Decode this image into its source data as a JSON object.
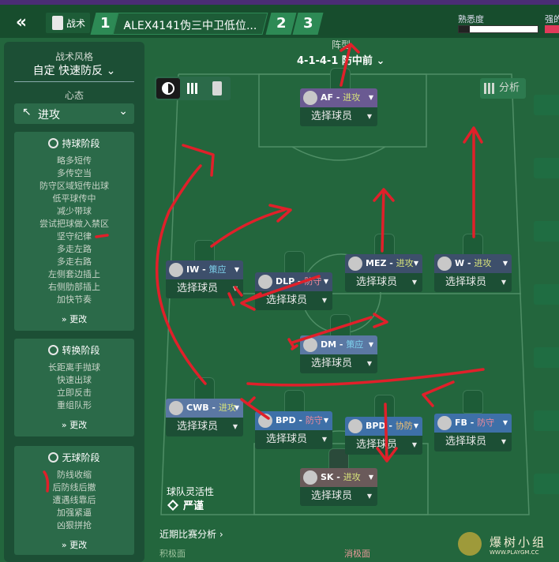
{
  "topbar": {
    "tactics_label": "战术",
    "tabs": [
      "1",
      "2",
      "3"
    ],
    "tactic_name": "ALEX4141伪三中卫低位...",
    "familiarity_label": "熟悉度",
    "strength_label": "强的"
  },
  "sidebar": {
    "style_caption": "战术风格",
    "style_value": "自定 快速防反",
    "mentality_caption": "心态",
    "mentality_value": "进攻",
    "in_possession": {
      "title": "持球阶段",
      "items": [
        "略多短传",
        "多传空当",
        "防守区域短传出球",
        "低平球传中",
        "减少带球",
        "尝试把球做入禁区",
        "坚守纪律",
        "多走左路",
        "多走右路",
        "左侧套边插上",
        "右侧肋部插上",
        "加快节奏"
      ],
      "more": "更改"
    },
    "transition": {
      "title": "转换阶段",
      "items": [
        "长距离手抛球",
        "快速出球",
        "立即反击",
        "重组队形"
      ],
      "more": "更改"
    },
    "out_of_possession": {
      "title": "无球阶段",
      "items": [
        "防线收缩",
        "后防线后撤",
        "遭遇线靠后",
        "加强紧逼",
        "凶狠拼抢"
      ],
      "more": "更改"
    }
  },
  "pitch": {
    "formation_caption": "阵型",
    "formation": "4-1-4-1 防中前",
    "analysis_label": "分析",
    "flexibility_caption": "球队灵活性",
    "flexibility_value": "严谨",
    "recent_label": "近期比赛分析",
    "positive_label": "积极面",
    "negative_label": "消极面",
    "select_player": "选择球员",
    "players": [
      {
        "pos": "AF",
        "duty": "进攻",
        "color": "#6a5a92"
      },
      {
        "pos": "IW",
        "duty": "策应",
        "color": "#3d4f6b"
      },
      {
        "pos": "DLP",
        "duty": "防守",
        "color": "#3d4f6b"
      },
      {
        "pos": "MEZ",
        "duty": "进攻",
        "color": "#3d4f6b"
      },
      {
        "pos": "W",
        "duty": "进攻",
        "color": "#3d4f6b"
      },
      {
        "pos": "DM",
        "duty": "策应",
        "color": "#5b78a3"
      },
      {
        "pos": "CWB",
        "duty": "进攻",
        "color": "#5b78a3"
      },
      {
        "pos": "BPD",
        "duty": "防守",
        "color": "#3e70a8"
      },
      {
        "pos": "BPD",
        "duty": "协防",
        "color": "#3e70a8"
      },
      {
        "pos": "FB",
        "duty": "防守",
        "color": "#3e70a8"
      },
      {
        "pos": "SK",
        "duty": "进攻",
        "color": "#6a5a5a"
      }
    ]
  },
  "watermark": {
    "title": "爆树小组",
    "url": "WWW.PLAYGM.CC"
  }
}
